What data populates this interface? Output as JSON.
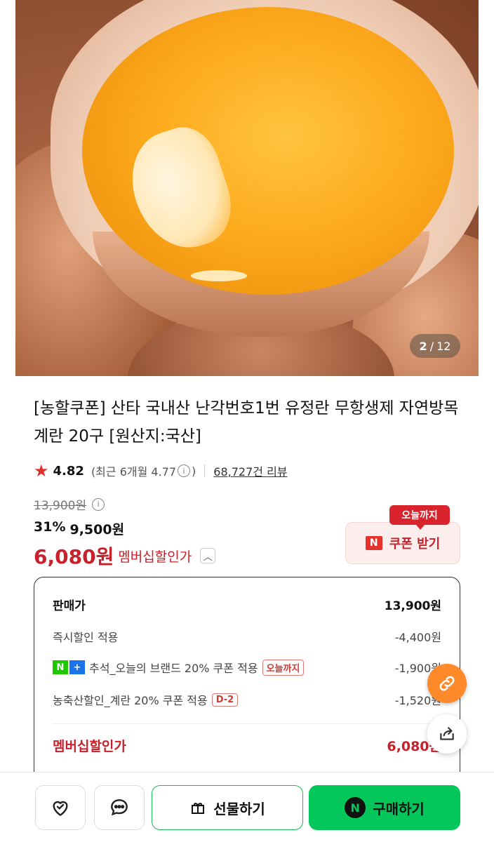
{
  "gallery": {
    "current": "2",
    "separator": "/",
    "total": "12"
  },
  "product": {
    "title": "[농할쿠폰] 산타 국내산 난각번호1번 유정란 무항생제 자연방목 계란 20구 [원산지:국산]",
    "rating": "4.82",
    "recent_prefix": "(최근 6개월 4.77",
    "recent_suffix": ")",
    "info_glyph": "i",
    "reviews": "68,727건 리뷰"
  },
  "price": {
    "original": "13,900원",
    "discount_rate": "31%",
    "sale": "9,500원",
    "member_price": "6,080원",
    "member_label": "멤버십할인가"
  },
  "coupon": {
    "badge": "오늘까지",
    "n_glyph": "N",
    "label": "쿠폰 받기"
  },
  "breakdown": {
    "rows": [
      {
        "label": "판매가",
        "value": "13,900원"
      },
      {
        "label": "즉시할인 적용",
        "value": "-4,400원"
      },
      {
        "label": "추석_오늘의 브랜드 20% 쿠폰 적용",
        "badge": "오늘까지",
        "value": "-1,900원"
      },
      {
        "label": "농축산할인_계란 20% 쿠폰 적용",
        "badge": "D-2",
        "value": "-1,520원"
      }
    ],
    "total_label": "멤버십할인가",
    "total_value": "6,080원"
  },
  "bottom_bar": {
    "gift_label": "선물하기",
    "buy_label": "구매하기",
    "buy_n": "N"
  },
  "icons": [
    "heart-check-icon",
    "chat-bubble-icon",
    "gift-icon",
    "share-icon",
    "link-icon",
    "star-icon"
  ],
  "colors": {
    "accent_red": "#c8212b",
    "naver_green": "#03c75a",
    "float_orange": "#ff8a2a"
  }
}
